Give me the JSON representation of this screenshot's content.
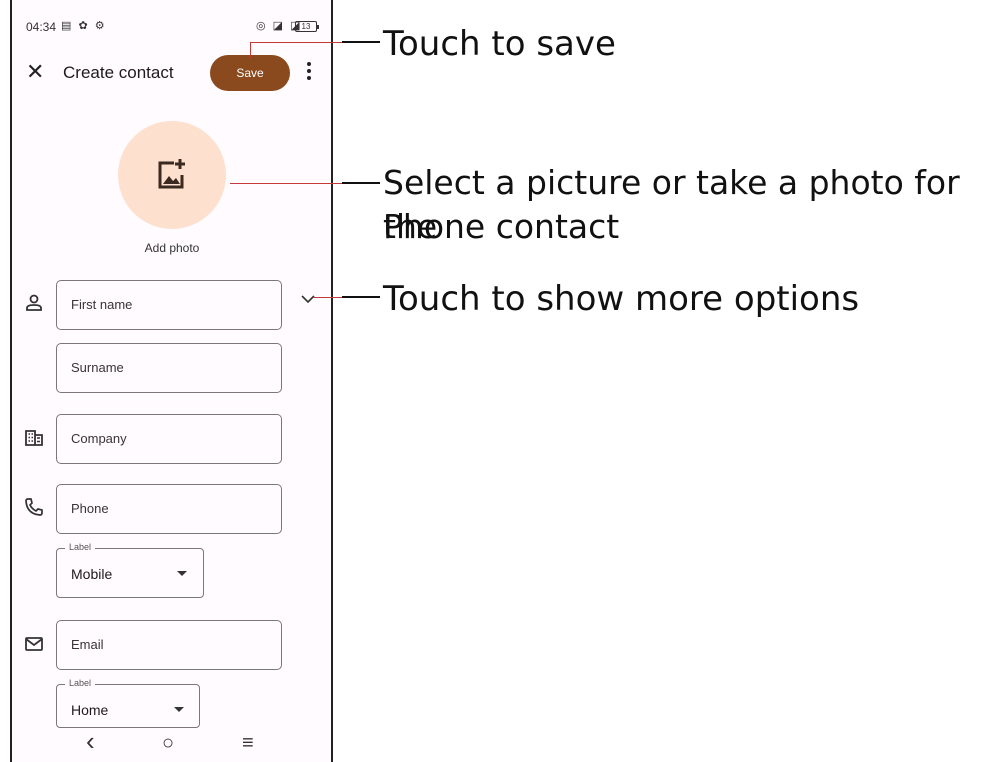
{
  "status_bar": {
    "time": "04:34",
    "left_icons": "▤ ✿ ⚙",
    "right_icons": "◎ ◪ ◪",
    "battery": "13"
  },
  "appbar": {
    "close_symbol": "✕",
    "title": "Create contact",
    "save_label": "Save"
  },
  "photo": {
    "label": "Add photo",
    "icon": "add-photo-icon"
  },
  "fields": {
    "first_name": "First name",
    "surname": "Surname",
    "company": "Company",
    "phone": "Phone",
    "email": "Email"
  },
  "phone_label": {
    "legend": "Label",
    "value": "Mobile"
  },
  "email_label": {
    "legend": "Label",
    "value": "Home"
  },
  "nav": {
    "back": "‹",
    "home": "○",
    "recents": "≡"
  },
  "annotations": {
    "save": "Touch to save",
    "photo_line1": "Select a picture or take a photo for the",
    "photo_line2": "Phone contact",
    "more": "Touch to show more options"
  },
  "colors": {
    "accent": "#8a4a1e",
    "photo_bg": "#fde0cd",
    "callout_line": "#c23a3a"
  }
}
